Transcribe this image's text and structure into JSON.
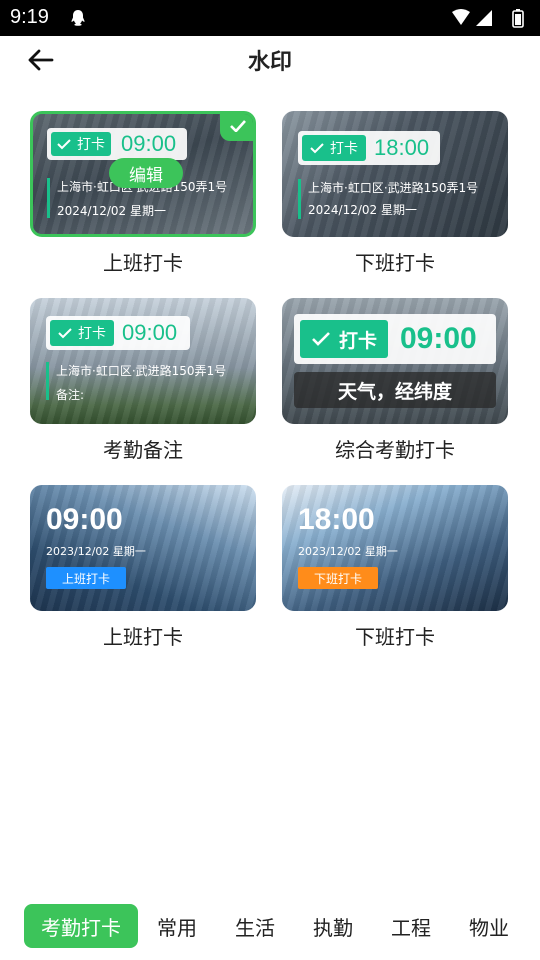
{
  "status_bar": {
    "time": "9:19"
  },
  "header": {
    "title": "水印"
  },
  "cards": [
    {
      "label": "上班打卡",
      "badge": "打卡",
      "time": "09:00",
      "address": "上海市·虹口区·武进路150弄1号",
      "date": "2024/12/02 星期一",
      "edit": "编辑",
      "selected": true
    },
    {
      "label": "下班打卡",
      "badge": "打卡",
      "time": "18:00",
      "address": "上海市·虹口区·武进路150弄1号",
      "date": "2024/12/02 星期一"
    },
    {
      "label": "考勤备注",
      "badge": "打卡",
      "time": "09:00",
      "address": "上海市·虹口区·武进路150弄1号",
      "note": "备注:"
    },
    {
      "label": "综合考勤打卡",
      "badge": "打卡",
      "time": "09:00",
      "info": "天气，经纬度"
    },
    {
      "label": "上班打卡",
      "time": "09:00",
      "date": "2023/12/02 星期一",
      "tag": "上班打卡",
      "tag_color": "#1e90ff"
    },
    {
      "label": "下班打卡",
      "time": "18:00",
      "date": "2023/12/02 星期一",
      "tag": "下班打卡",
      "tag_color": "#ff8c1a"
    }
  ],
  "tabs": [
    {
      "label": "考勤打卡",
      "active": true
    },
    {
      "label": "常用"
    },
    {
      "label": "生活"
    },
    {
      "label": "执勤"
    },
    {
      "label": "工程"
    },
    {
      "label": "物业"
    }
  ],
  "colors": {
    "accent": "#3cc45a",
    "watermark_green": "#19c08b"
  }
}
